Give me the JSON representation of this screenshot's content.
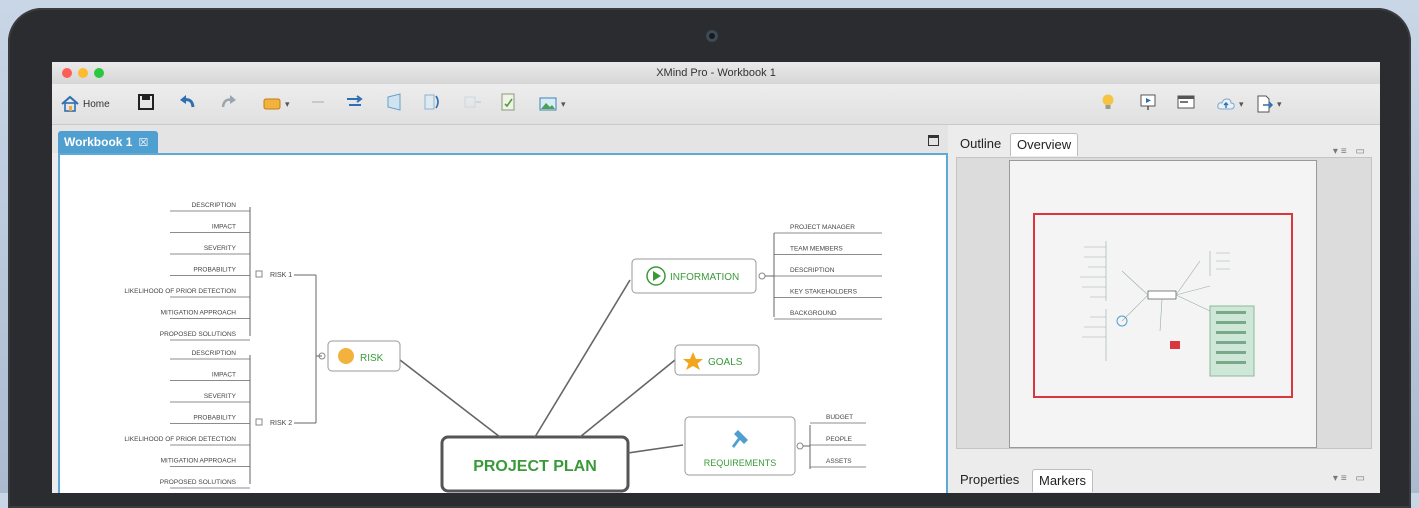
{
  "window": {
    "title": "XMind Pro - Workbook 1"
  },
  "toolbar": {
    "home_label": "Home"
  },
  "editor_tab": {
    "label": "Workbook 1",
    "close_glyph": "☒"
  },
  "right_panel": {
    "top_tabs": [
      "Outline",
      "Overview"
    ],
    "active_top_tab": "Overview",
    "bottom_tabs": [
      "Properties",
      "Markers"
    ],
    "active_bottom_tab": "Markers",
    "panel_controls": "▾≡ ▭"
  },
  "mindmap": {
    "central": "PROJECT PLAN",
    "risk": {
      "label": "RISK",
      "groups": [
        {
          "label": "RISK 1",
          "items": [
            "DESCRIPTION",
            "IMPACT",
            "SEVERITY",
            "PROBABILITY",
            "LIKELIHOOD OF PRIOR DETECTION",
            "MITIGATION APPROACH",
            "PROPOSED SOLUTIONS"
          ]
        },
        {
          "label": "RISK 2",
          "items": [
            "DESCRIPTION",
            "IMPACT",
            "SEVERITY",
            "PROBABILITY",
            "LIKELIHOOD OF PRIOR DETECTION",
            "MITIGATION APPROACH",
            "PROPOSED SOLUTIONS"
          ]
        }
      ]
    },
    "information": {
      "label": "INFORMATION",
      "items": [
        "PROJECT MANAGER",
        "TEAM MEMBERS",
        "DESCRIPTION",
        "KEY STAKEHOLDERS",
        "BACKGROUND"
      ]
    },
    "goals": {
      "label": "GOALS"
    },
    "requirements": {
      "label": "REQUIREMENTS",
      "items": [
        "BUDGET",
        "PEOPLE",
        "ASSETS"
      ]
    }
  },
  "colors": {
    "accent": "#4f9fd0",
    "node_text": "#3a9a3a",
    "overview_frame": "#d9363e"
  }
}
